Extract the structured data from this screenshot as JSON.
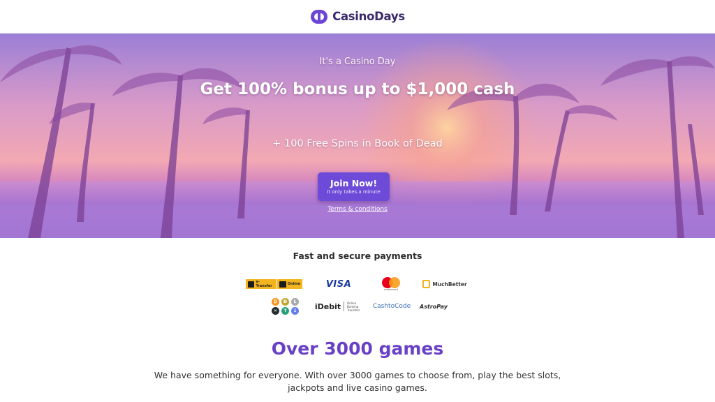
{
  "header": {
    "brand": "CasinoDays"
  },
  "hero": {
    "eyebrow": "It's a Casino Day",
    "headline": "Get 100% bonus up to $1,000 cash",
    "subline": "+ 100 Free Spins in Book of Dead",
    "cta_label": "Join Now!",
    "cta_sublabel": "It only takes a minute",
    "terms_link": "Terms & conditions"
  },
  "payments": {
    "title": "Fast and secure payments",
    "methods": {
      "interac_etransfer": "e-Transfer",
      "interac_online": "Online",
      "visa": "VISA",
      "mastercard": "mastercard",
      "muchbetter": "MuchBetter",
      "idebit": "iDebit",
      "idebit_tagline": "Online Banking Transfers",
      "cashtocode": "CashtoCode",
      "astropay": "AstroPay"
    },
    "crypto_symbols": [
      "₿",
      "Ð",
      "Ł",
      "✕",
      "T",
      "Ξ"
    ]
  },
  "games": {
    "title": "Over 3000 games",
    "description": "We have something for everyone. With over 3000 games to choose from, play the best slots, jackpots and live casino games."
  },
  "colors": {
    "brand_purple": "#6941c6",
    "cta_purple": "#6d4bd8",
    "logo_dark": "#3b2a6b"
  }
}
